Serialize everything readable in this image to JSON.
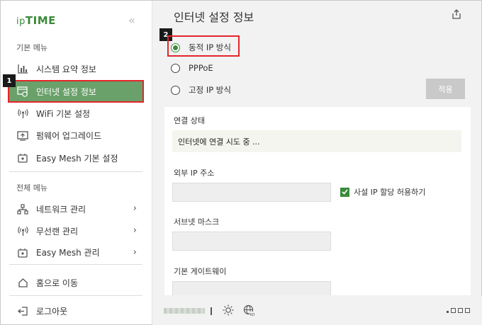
{
  "logo": {
    "prefix": "ip",
    "name": "TIME"
  },
  "sidebar": {
    "basic_label": "기본 메뉴",
    "basic_items": [
      {
        "label": "시스템 요약 정보",
        "icon": "bar-chart-icon"
      },
      {
        "label": "인터넷 설정 정보",
        "icon": "internet-settings-icon",
        "active": true
      },
      {
        "label": "WiFi 기본 설정",
        "icon": "wifi-icon"
      },
      {
        "label": "펌웨어 업그레이드",
        "icon": "firmware-icon"
      },
      {
        "label": "Easy Mesh 기본 설정",
        "icon": "mesh-icon"
      }
    ],
    "full_label": "전체 메뉴",
    "full_items": [
      {
        "label": "네트워크 관리",
        "icon": "network-icon"
      },
      {
        "label": "무선랜 관리",
        "icon": "wireless-icon"
      },
      {
        "label": "Easy Mesh 관리",
        "icon": "mesh-icon"
      }
    ],
    "home": "홈으로 이동",
    "logout": "로그아웃"
  },
  "badges": {
    "one": "1",
    "two": "2"
  },
  "main": {
    "title": "인터넷 설정 정보",
    "options": [
      {
        "label": "동적 IP 방식",
        "checked": true
      },
      {
        "label": "PPPoE",
        "checked": false
      },
      {
        "label": "고정 IP 방식",
        "checked": false
      }
    ],
    "apply": "적용",
    "connection_status_label": "연결 상태",
    "connection_status_value": "인터넷에 연결 시도 중 ...",
    "external_ip_label": "외부 IP 주소",
    "private_ip_checkbox": "사설 IP 할당 허용하기",
    "subnet_label": "서브넷 마스크",
    "gateway_label": "기본 게이트웨이"
  },
  "colors": {
    "accent": "#3b8a3a",
    "active_bg": "#6aa06a",
    "highlight": "#e3262b"
  }
}
